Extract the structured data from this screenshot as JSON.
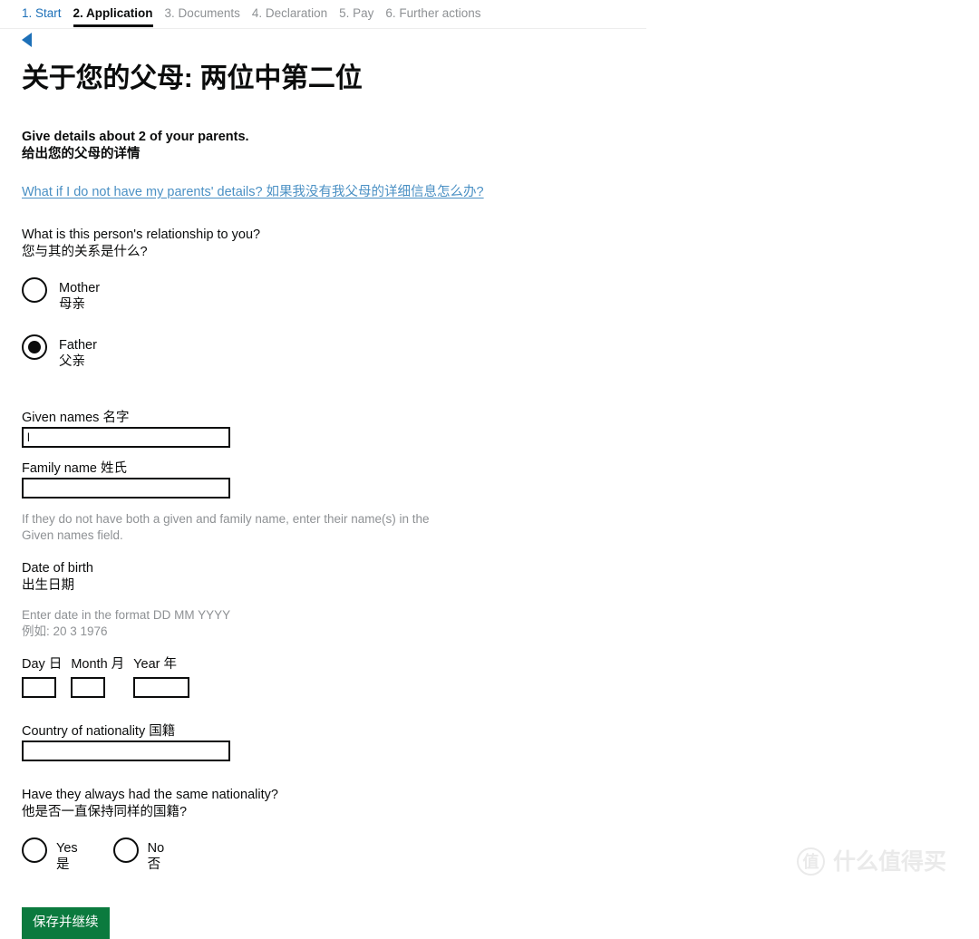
{
  "steps": [
    {
      "label": "1. Start",
      "state": "link"
    },
    {
      "label": "2. Application",
      "state": "current"
    },
    {
      "label": "3. Documents",
      "state": "upcoming"
    },
    {
      "label": "4. Declaration",
      "state": "upcoming"
    },
    {
      "label": "5. Pay",
      "state": "upcoming"
    },
    {
      "label": "6. Further actions",
      "state": "upcoming"
    }
  ],
  "nav": {
    "back_icon": "back-triangle-icon"
  },
  "page": {
    "title": "关于您的父母: 两位中第二位",
    "lede_en": "Give details about 2 of your parents.",
    "lede_cn": "给出您的父母的详情",
    "help_link": "What if I do not have my parents' details? 如果我没有我父母的详细信息怎么办?"
  },
  "relationship": {
    "question_en": "What is this person's relationship to you?",
    "question_cn": "您与其的关系是什么?",
    "options": [
      {
        "en": "Mother",
        "cn": "母亲",
        "selected": false
      },
      {
        "en": "Father",
        "cn": "父亲",
        "selected": true
      }
    ]
  },
  "names": {
    "given_label": "Given names 名字",
    "given_value": "l",
    "family_label": "Family name 姓氏",
    "family_value": "",
    "hint": "If they do not have both a given and family name, enter their name(s) in the Given names field."
  },
  "dob": {
    "label_en": "Date of birth",
    "label_cn": "出生日期",
    "format_hint_en": "Enter date in the format DD MM YYYY",
    "format_hint_cn": "例如: 20 3 1976",
    "day_label": "Day 日",
    "day_value": "",
    "month_label": "Month 月",
    "month_value": "",
    "year_label": "Year 年",
    "year_value": ""
  },
  "nationality": {
    "country_label": "Country of nationality 国籍",
    "country_value": "",
    "same_question_en": "Have they always had the same nationality?",
    "same_question_cn": "他是否一直保持同样的国籍?",
    "options": [
      {
        "en": "Yes",
        "cn": "是",
        "selected": false
      },
      {
        "en": "No",
        "cn": "否",
        "selected": false
      }
    ]
  },
  "actions": {
    "save_label": "保存并继续",
    "save_color": "#0b7a3e"
  },
  "watermark": {
    "badge": "值",
    "text": "什么值得买"
  },
  "colors": {
    "link": "#1d70b8",
    "help_link": "#4a90c4",
    "text": "#0b0c0c",
    "muted": "#8e9194",
    "green": "#0b7a3e"
  }
}
